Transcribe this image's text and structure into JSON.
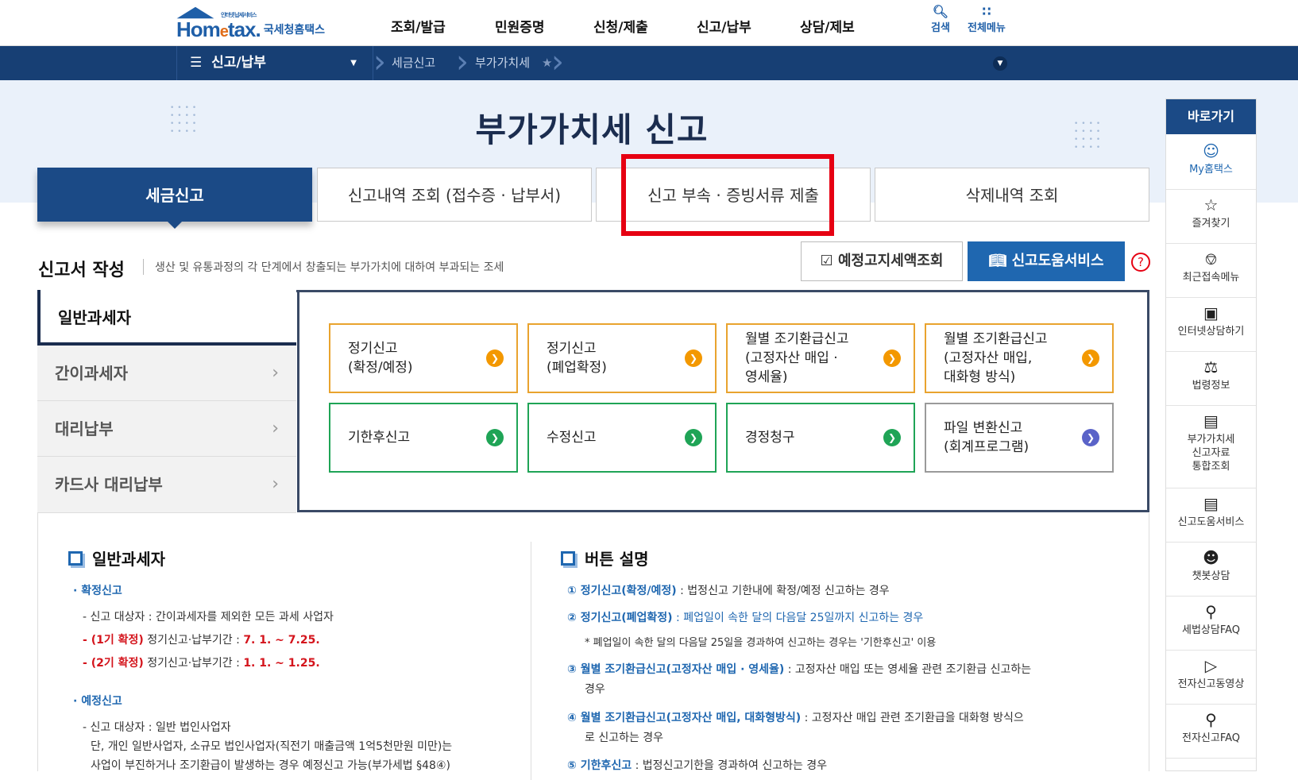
{
  "header": {
    "logo_text_home": "Hom",
    "logo_text_e": "e",
    "logo_text_tax": "tax.",
    "logo_sub": "인터넷 납세서비스",
    "logo_kr": "국세청홈택스",
    "menu": [
      "조회/발급",
      "민원증명",
      "신청/제출",
      "신고/납부",
      "상담/제보"
    ],
    "search_label": "검색",
    "all_menu_label": "전체메뉴"
  },
  "navbar": {
    "category": "신고/납부",
    "crumbs": [
      "세금신고",
      "부가가치세"
    ]
  },
  "page_title": "부가가치세  신고",
  "tabs": [
    "세금신고",
    "신고내역 조회 (접수증 · 납부서)",
    "신고 부속 · 증빙서류 제출",
    "삭제내역 조회"
  ],
  "section": {
    "title": "신고서 작성",
    "desc": "생산 및 유통과정의 각 단계에서 창출되는 부가가치에 대하여 부과되는 조세",
    "btn_prenotice": "예정고지세액조회",
    "btn_help": "신고도움서비스",
    "help_icon": "?"
  },
  "side_menu": [
    "일반과세자",
    "간이과세자",
    "대리납부",
    "카드사 대리납부"
  ],
  "cards": [
    {
      "line1": "정기신고",
      "line2": "(확정/예정)",
      "line3": ""
    },
    {
      "line1": "정기신고",
      "line2": "(폐업확정)",
      "line3": ""
    },
    {
      "line1": "월별 조기환급신고",
      "line2": "(고정자산 매입 ·",
      "line3": "영세율)"
    },
    {
      "line1": "월별 조기환급신고",
      "line2": "(고정자산 매입,",
      "line3": "대화형 방식)"
    },
    {
      "line1": "기한후신고",
      "line2": "",
      "line3": ""
    },
    {
      "line1": "수정신고",
      "line2": "",
      "line3": ""
    },
    {
      "line1": "경정청구",
      "line2": "",
      "line3": ""
    },
    {
      "line1": "파일 변환신고",
      "line2": "(회계프로그램)",
      "line3": ""
    }
  ],
  "left_info": {
    "title": "일반과세자",
    "h_confirm": "· 확정신고",
    "confirm_target": "- 신고 대상자 : 간이과세자를 제외한 모든 과세 사업자",
    "c1_tag": "(1기 확정)",
    "c1_mid": " 정기신고·납부기간 : ",
    "c1_date": "7. 1. ~ 7.25.",
    "c2_tag": "(2기 확정)",
    "c2_mid": " 정기신고·납부기간 : ",
    "c2_date": "1. 1. ~ 1.25.",
    "h_pre": "· 예정신고",
    "pre_target": "- 신고 대상자 : 일반 법인사업자",
    "pre_l2": "단, 개인 일반사업자, 소규모 법인사업자(직전기 매출금액 1억5천만원 미만)는",
    "pre_l3": "사업이 부진하거나 조기환급이 발생하는 경우 예정신고 가능(부가세법 §48④)"
  },
  "right_info": {
    "title": "버튼 설명",
    "i1_b": "① 정기신고(확정/예정)",
    "i1_t": " : 법정신고 기한내에 확정/예정 신고하는 경우",
    "i2_b": "② 정기신고(폐업확정)",
    "i2_t": " : 폐업일이 속한 달의 다음달 25일까지 신고하는 경우",
    "i2_note": "* 폐업일이 속한 달의 다음달 25일을 경과하여 신고하는 경우는 '기한후신고' 이용",
    "i3_b": "③ 월별 조기환급신고(고정자산 매입 · 영세율)",
    "i3_t": " : 고정자산 매입 또는 영세율 관련 조기환급 신고하는",
    "i3_t2": "경우",
    "i4_b": "④ 월별 조기환급신고(고정자산 매입, 대화형방식)",
    "i4_t": " : 고정자산 매입 관련 조기환급을 대화형 방식으",
    "i4_t2": "로 신고하는 경우",
    "i5_b": "⑤ 기한후신고",
    "i5_t": " : 법정신고기한을 경과하여 신고하는 경우"
  },
  "quick": {
    "title": "바로가기",
    "items": [
      "My홈택스",
      "즐겨찾기",
      "최근접속메뉴",
      "인터넷상담하기",
      "법령정보",
      "부가가치세\n신고자료\n통합조회",
      "신고도움서비스",
      "챗봇상담",
      "세법상담FAQ",
      "전자신고동영상",
      "전자신고FAQ"
    ]
  }
}
